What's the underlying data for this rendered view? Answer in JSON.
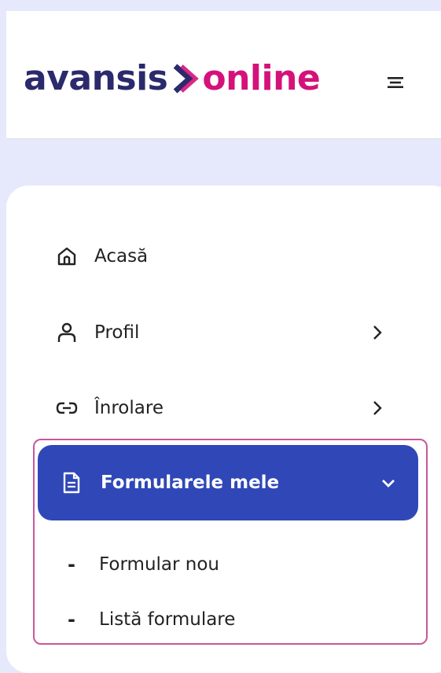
{
  "header": {
    "logo_part1": "avansis",
    "logo_part2": "online",
    "colors": {
      "logo_dark": "#2a2a6c",
      "logo_accent": "#d4127a"
    },
    "menu_icon": "hamburger-menu-icon"
  },
  "nav": {
    "items": [
      {
        "label": "Acasă",
        "icon": "home-icon",
        "has_chevron": false
      },
      {
        "label": "Profil",
        "icon": "user-icon",
        "has_chevron": true
      },
      {
        "label": "Înrolare",
        "icon": "link-icon",
        "has_chevron": true
      }
    ],
    "active": {
      "label": "Formularele mele",
      "icon": "document-icon",
      "expanded": true,
      "color": "#2f47b7"
    },
    "subitems": [
      {
        "dash": "-",
        "label": "Formular nou"
      },
      {
        "dash": "-",
        "label": "Listă formulare"
      }
    ]
  },
  "highlight_color": "#c8579a"
}
